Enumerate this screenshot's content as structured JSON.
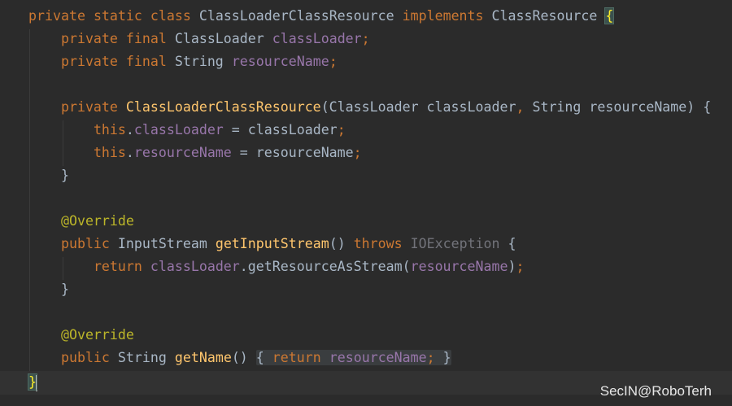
{
  "code": {
    "l1": {
      "private": "private",
      "static": "static",
      "class": "class",
      "class_name": "ClassLoaderClassResource",
      "implements": "implements",
      "iface": "ClassResource",
      "open_brace": "{"
    },
    "l2": {
      "private": "private",
      "final": "final",
      "type": "ClassLoader",
      "name": "classLoader",
      "semi": ";"
    },
    "l3": {
      "private": "private",
      "final": "final",
      "type": "String",
      "name": "resourceName",
      "semi": ";"
    },
    "l5": {
      "private": "private",
      "ctor": "ClassLoaderClassResource",
      "p1": "(ClassLoader classLoader",
      "comma": ",",
      "p2": " String resourceName) {"
    },
    "l6": {
      "this": "this",
      "dot": ".",
      "field": "classLoader",
      "rest": " = classLoader",
      "semi": ";"
    },
    "l7": {
      "this": "this",
      "dot": ".",
      "field": "resourceName",
      "rest": " = resourceName",
      "semi": ";"
    },
    "l8": {
      "close": "}"
    },
    "l10": {
      "annotation": "@Override"
    },
    "l11": {
      "public": "public",
      "type": "InputStream",
      "method": "getInputStream",
      "parens": "()",
      "throws": "throws",
      "exception": "IOException",
      "open": "{"
    },
    "l12": {
      "return": "return",
      "field": "classLoader",
      "call": ".getResourceAsStream(",
      "arg": "resourceName",
      "close": ")",
      "semi": ";"
    },
    "l13": {
      "close": "}"
    },
    "l15": {
      "annotation": "@Override"
    },
    "l16": {
      "public": "public",
      "type": "String",
      "method": "getName",
      "parens": "()",
      "open": "{",
      "return": "return",
      "field": "resourceName",
      "semi": ";",
      "close": "}"
    },
    "l17": {
      "close": "}"
    }
  },
  "watermark": "SecIN@RoboTerh",
  "colors": {
    "background": "#2b2b2b",
    "keyword": "#cc7832",
    "field": "#9876aa",
    "method_declaration": "#ffc66d",
    "annotation": "#bbb529",
    "plain_text": "#a9b7c6",
    "unused": "#72737a",
    "brace_match": "#ffef28"
  }
}
